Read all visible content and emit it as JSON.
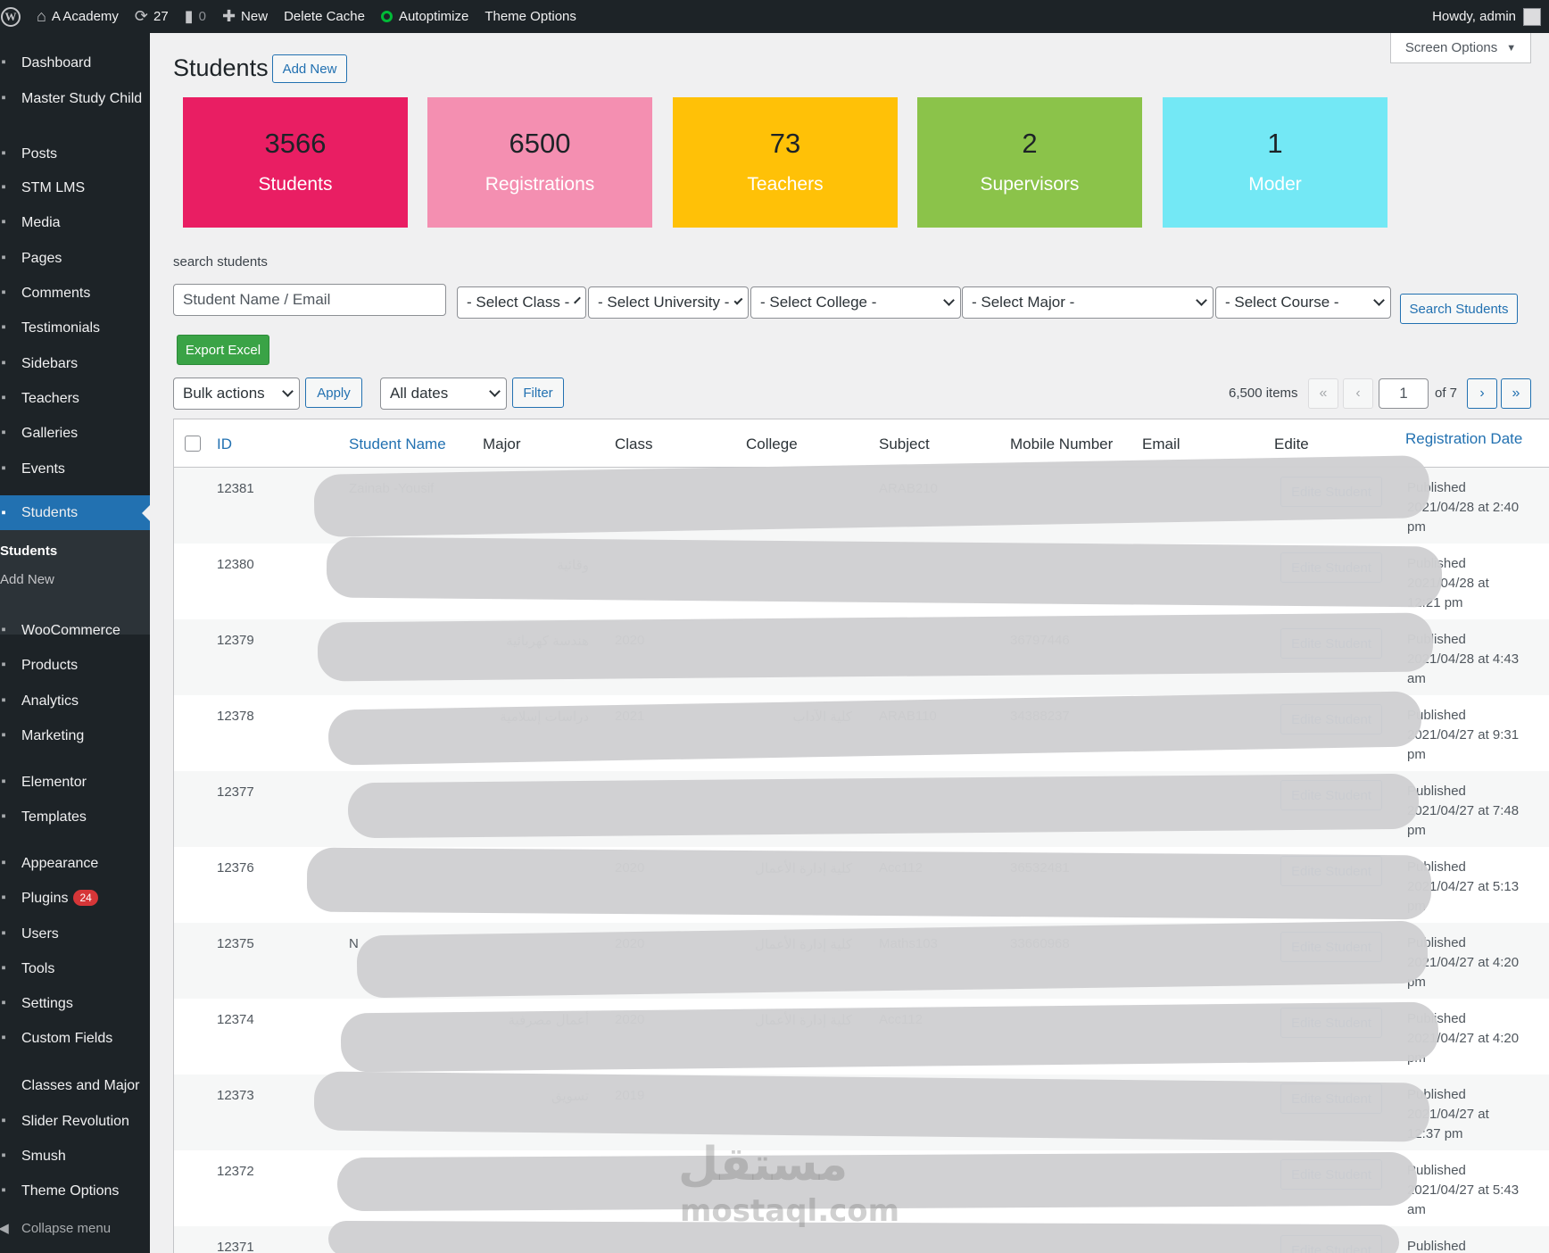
{
  "adminbar": {
    "site_name": "A Academy",
    "updates_count": "27",
    "comments_count": "0",
    "new_label": "New",
    "delete_cache": "Delete Cache",
    "autoptimize": "Autoptimize",
    "theme_options": "Theme Options",
    "howdy": "Howdy, admin"
  },
  "sidebar": {
    "items": [
      {
        "label": "Dashboard",
        "icon": "dashboard-icon"
      },
      {
        "label": "Master Study Child",
        "icon": "m-logo-icon"
      },
      {
        "label": "Posts",
        "icon": "pin-icon"
      },
      {
        "label": "STM LMS",
        "icon": "layers-icon"
      },
      {
        "label": "Media",
        "icon": "media-icon"
      },
      {
        "label": "Pages",
        "icon": "page-icon"
      },
      {
        "label": "Comments",
        "icon": "comment-icon"
      },
      {
        "label": "Testimonials",
        "icon": "comment-icon"
      },
      {
        "label": "Sidebars",
        "icon": "list-icon"
      },
      {
        "label": "Teachers",
        "icon": "pin-icon"
      },
      {
        "label": "Galleries",
        "icon": "gallery-icon"
      },
      {
        "label": "Events",
        "icon": "calendar-icon"
      },
      {
        "label": "Students",
        "icon": "pin-icon"
      },
      {
        "label": "WooCommerce",
        "icon": "woo-icon"
      },
      {
        "label": "Products",
        "icon": "archive-icon"
      },
      {
        "label": "Analytics",
        "icon": "chart-icon"
      },
      {
        "label": "Marketing",
        "icon": "megaphone-icon"
      },
      {
        "label": "Elementor",
        "icon": "elementor-icon"
      },
      {
        "label": "Templates",
        "icon": "folder-icon"
      },
      {
        "label": "Appearance",
        "icon": "brush-icon"
      },
      {
        "label": "Plugins",
        "icon": "plug-icon",
        "badge": "24"
      },
      {
        "label": "Users",
        "icon": "users-icon"
      },
      {
        "label": "Tools",
        "icon": "wrench-icon"
      },
      {
        "label": "Settings",
        "icon": "settings-icon"
      },
      {
        "label": "Custom Fields",
        "icon": "grid-icon"
      },
      {
        "label": "Classes and Major",
        "icon": ""
      },
      {
        "label": "Slider Revolution",
        "icon": "refresh-icon"
      },
      {
        "label": "Smush",
        "icon": "smush-icon"
      },
      {
        "label": "Theme Options",
        "icon": "pin-icon"
      }
    ],
    "submenu": {
      "students": "Students",
      "add_new": "Add New"
    },
    "collapse": "Collapse menu"
  },
  "page": {
    "title": "Students",
    "add_new": "Add New",
    "screen_options": "Screen Options"
  },
  "stats": [
    {
      "value": "3566",
      "label": "Students",
      "color": "#e91e63"
    },
    {
      "value": "6500",
      "label": "Registrations",
      "color": "#f48fb1"
    },
    {
      "value": "73",
      "label": "Teachers",
      "color": "#ffc107"
    },
    {
      "value": "2",
      "label": "Supervisors",
      "color": "#8bc34a"
    },
    {
      "value": "1",
      "label": "Moder",
      "color": "#73e8f5"
    }
  ],
  "search": {
    "label": "search students",
    "placeholder": "Student Name / Email",
    "class": "- Select Class -",
    "university": "- Select University -",
    "college": "- Select College -",
    "major": "- Select Major -",
    "course": "- Select Course -",
    "button": "Search Students"
  },
  "export_button": "Export Excel",
  "tablenav": {
    "bulk": "Bulk actions",
    "apply": "Apply",
    "dates": "All dates",
    "filter": "Filter",
    "items": "6,500 items",
    "first": "«",
    "prev": "‹",
    "current_page": "1",
    "of_pages": "of 7",
    "next": "›",
    "last": "»"
  },
  "table": {
    "headers": {
      "id": "ID",
      "name": "Student Name",
      "major": "Major",
      "class": "Class",
      "college": "College",
      "subject": "Subject",
      "mobile": "Mobile Number",
      "email": "Email",
      "edit": "Edite",
      "date": "Registration Date"
    },
    "edit_label": "Edite Student",
    "rows": [
      {
        "id": "12381",
        "name": "Zainab -Yousif",
        "major": "",
        "class": "",
        "college": "",
        "subject": "ARAB210",
        "mobile": "",
        "email": "",
        "status": "Published",
        "date1": "2021/04/28 at 2:40",
        "date2": "pm"
      },
      {
        "id": "12380",
        "name": "",
        "major": "وقائية",
        "class": "",
        "college": "",
        "subject": "",
        "mobile": "",
        "email": "",
        "status": "Published",
        "date1": "2021/04/28 at",
        "date2": "12:21 pm"
      },
      {
        "id": "12379",
        "name": "",
        "major": "هندسة كهربائية",
        "class": "2020",
        "college": "",
        "subject": "",
        "mobile": "36797446",
        "email": "",
        "status": "Published",
        "date1": "2021/04/28 at 4:43",
        "date2": "am"
      },
      {
        "id": "12378",
        "name": "",
        "major": "دراسات إسلامية",
        "class": "2021",
        "college": "كلية الآداب",
        "subject": "ARAB110",
        "mobile": "34388237",
        "email": "",
        "status": "Published",
        "date1": "2021/04/27 at 9:31",
        "date2": "pm"
      },
      {
        "id": "12377",
        "name": "",
        "major": "",
        "class": "",
        "college": "",
        "subject": "",
        "mobile": "",
        "email": "",
        "status": "Published",
        "date1": "2021/04/27 at 7:48",
        "date2": "pm"
      },
      {
        "id": "12376",
        "name": "",
        "major": "",
        "class": "2020",
        "college": "كلية إدارة الأعمال",
        "subject": "Acc112",
        "mobile": "36532481",
        "email": "",
        "status": "Published",
        "date1": "2021/04/27 at 5:13",
        "date2": "pm"
      },
      {
        "id": "12375",
        "name": "N",
        "major": "",
        "class": "2020",
        "college": "كلية إدارة الأعمال",
        "subject": "Maths103",
        "mobile": "33660968",
        "email": "",
        "status": "Published",
        "date1": "2021/04/27 at 4:20",
        "date2": "pm"
      },
      {
        "id": "12374",
        "name": "",
        "major": "أعمال مصرفية",
        "class": "2020",
        "college": "كلية إدارة الأعمال",
        "subject": "Acc112",
        "mobile": "",
        "email": "",
        "status": "Published",
        "date1": "2021/04/27 at 4:20",
        "date2": "pm"
      },
      {
        "id": "12373",
        "name": "",
        "major": "تسويق",
        "class": "2019",
        "college": "",
        "subject": "",
        "mobile": "",
        "email": "",
        "status": "Published",
        "date1": "2021/04/27 at",
        "date2": "12:37 pm"
      },
      {
        "id": "12372",
        "name": "",
        "major": "",
        "class": "",
        "college": "",
        "subject": "",
        "mobile": "",
        "email": "",
        "status": "Published",
        "date1": "2021/04/27 at 5:43",
        "date2": "am"
      },
      {
        "id": "12371",
        "name": "",
        "major": "",
        "class": "",
        "college": "",
        "subject": "",
        "mobile": "",
        "email": "",
        "status": "Published",
        "date1": "",
        "date2": ""
      }
    ]
  },
  "watermark": {
    "arabic": "مستقل",
    "latin": "mostaql.com"
  }
}
